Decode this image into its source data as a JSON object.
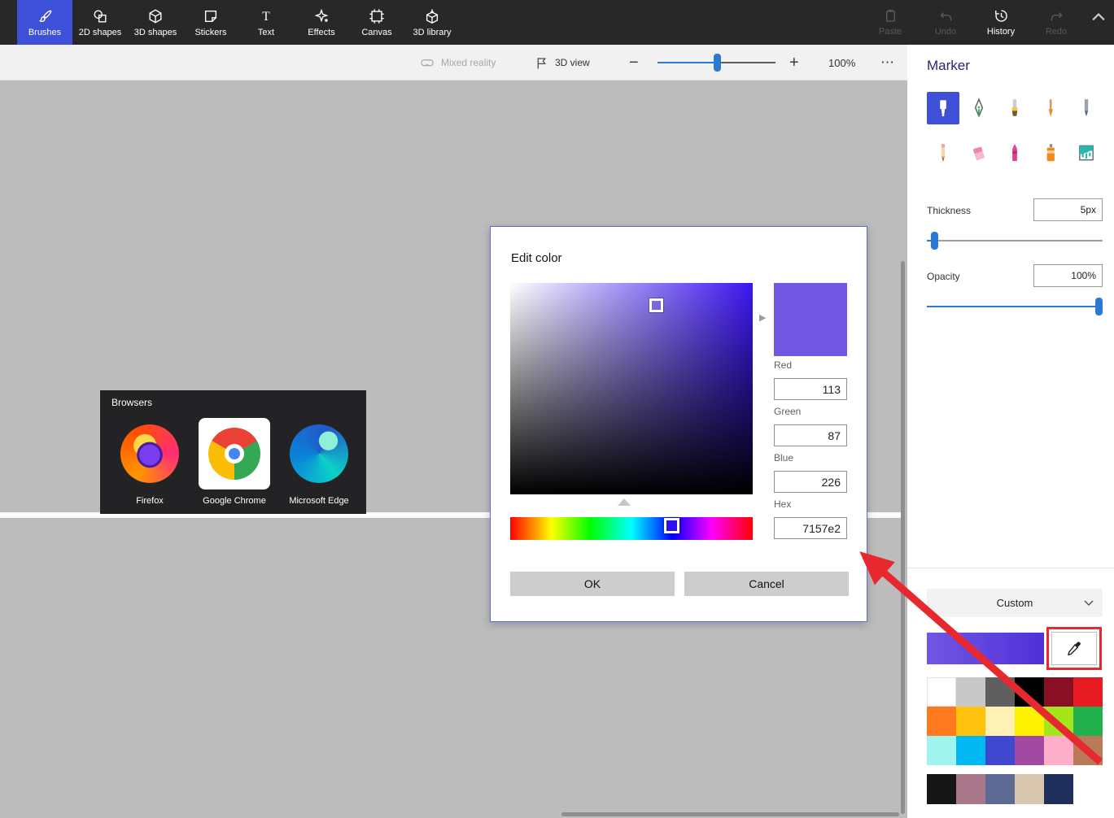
{
  "colors": {
    "accent": "#3e50d8",
    "slider_blue": "#2a7ad4",
    "annotation_red": "#e8282f",
    "canvas_gray": "#bcbcbc",
    "topbar_dark": "#282828"
  },
  "top_toolbar": {
    "tabs": [
      {
        "label": "Brushes",
        "selected": true
      },
      {
        "label": "2D shapes",
        "selected": false
      },
      {
        "label": "3D shapes",
        "selected": false
      },
      {
        "label": "Stickers",
        "selected": false
      },
      {
        "label": "Text",
        "selected": false
      },
      {
        "label": "Effects",
        "selected": false
      },
      {
        "label": "Canvas",
        "selected": false
      },
      {
        "label": "3D library",
        "selected": false
      }
    ],
    "actions": [
      {
        "label": "Paste",
        "enabled": false
      },
      {
        "label": "Undo",
        "enabled": false
      },
      {
        "label": "History",
        "enabled": true
      },
      {
        "label": "Redo",
        "enabled": false
      }
    ]
  },
  "view_bar": {
    "mixed_reality_label": "Mixed reality",
    "view_3d_label": "3D view",
    "zoom_out_label": "−",
    "zoom_in_label": "+",
    "zoom_value": "100%",
    "more_label": "⋯"
  },
  "canvas_content": {
    "browsers_panel": {
      "title": "Browsers",
      "apps": [
        {
          "label": "Firefox"
        },
        {
          "label": "Google Chrome"
        },
        {
          "label": "Microsoft Edge"
        }
      ]
    }
  },
  "edit_color_dialog": {
    "title": "Edit color",
    "fields": [
      {
        "label": "Red",
        "value": "113"
      },
      {
        "label": "Green",
        "value": "87"
      },
      {
        "label": "Blue",
        "value": "226"
      },
      {
        "label": "Hex",
        "value": "7157e2"
      }
    ],
    "ok_label": "OK",
    "cancel_label": "Cancel",
    "preview_color": "#7157e2",
    "hue_color": "#3c16f0",
    "hue_selector_color": "#2d12ee"
  },
  "sidebar": {
    "title": "Marker",
    "brushes": [
      "Marker",
      "Calligraphy pen",
      "Oil brush",
      "Watercolor",
      "Pixel pen",
      "Pencil",
      "Eraser",
      "Crayon",
      "Spray can",
      "Fill"
    ],
    "selected_brush": "Marker",
    "thickness_label": "Thickness",
    "thickness_value": "5px",
    "opacity_label": "Opacity",
    "opacity_value": "100%",
    "custom_label": "Custom",
    "custom_color_gradient": [
      "#7157e2",
      "#4f30d9"
    ],
    "palette": [
      "#ffffff",
      "#c8c8c8",
      "#5f5f5f",
      "#000000",
      "#8b0f23",
      "#e81b23",
      "#ff7a1e",
      "#ffc20e",
      "#fdf2b3",
      "#fff200",
      "#a2e61b",
      "#22b14c",
      "#a0f3ef",
      "#00b9f2",
      "#4048cf",
      "#a349a4",
      "#ffaec9",
      "#b97a57"
    ],
    "palette_extra": [
      "#161616",
      "#a8778a",
      "#5c6a94",
      "#d8c7ae",
      "#1e2f5c"
    ]
  }
}
